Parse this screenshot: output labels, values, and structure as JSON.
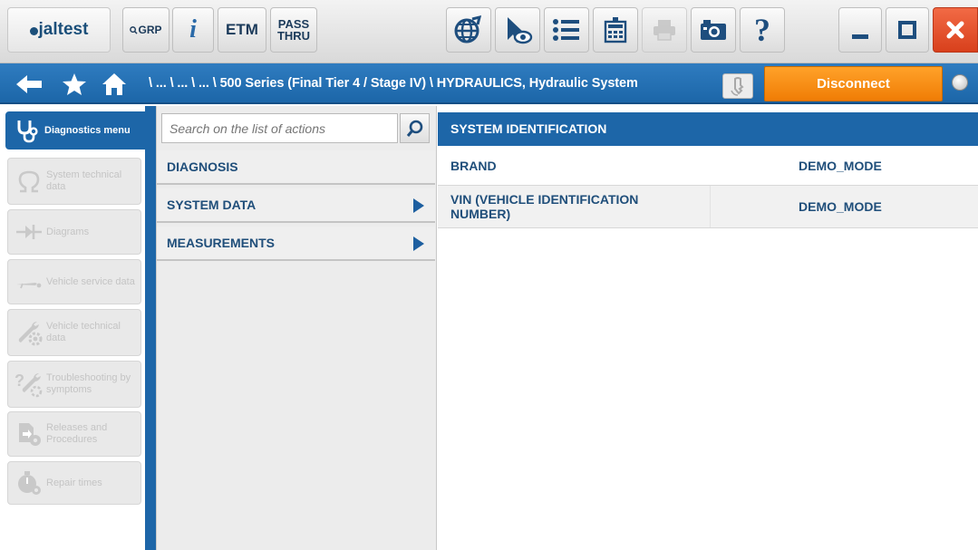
{
  "toolbar": {
    "logo_text": "jaltest",
    "grp_label": "GRP",
    "info_label": "i",
    "etm_label": "ETM",
    "passthru_line1": "PASS",
    "passthru_line2": "THRU",
    "help_label": "?"
  },
  "breadcrumb": {
    "path": "\\ ... \\ ... \\ ... \\ 500 Series (Final Tier 4 / Stage IV) \\ HYDRAULICS, Hydraulic System"
  },
  "disconnect_label": "Disconnect",
  "left_menu": {
    "items": [
      {
        "label": "Diagnostics menu",
        "icon": "stethoscope-icon",
        "active": true
      },
      {
        "label": "System technical data",
        "icon": "omega-icon",
        "active": false
      },
      {
        "label": "Diagrams",
        "icon": "diode-icon",
        "active": false
      },
      {
        "label": "Vehicle service data",
        "icon": "dipstick-icon",
        "active": false
      },
      {
        "label": "Vehicle technical data",
        "icon": "wrench-gear-icon",
        "active": false
      },
      {
        "label": "Troubleshooting by symptoms",
        "icon": "question-wrench-icon",
        "active": false
      },
      {
        "label": "Releases and Procedures",
        "icon": "document-gear-icon",
        "active": false
      },
      {
        "label": "Repair times",
        "icon": "stopwatch-icon",
        "active": false
      }
    ]
  },
  "search": {
    "placeholder": "Search on the list of actions"
  },
  "actions": [
    {
      "label": "DIAGNOSIS",
      "has_arrow": false
    },
    {
      "label": "SYSTEM DATA",
      "has_arrow": true
    },
    {
      "label": "MEASUREMENTS",
      "has_arrow": true
    }
  ],
  "panel": {
    "title": "SYSTEM IDENTIFICATION",
    "rows": [
      {
        "key": "BRAND",
        "value": "DEMO_MODE"
      },
      {
        "key": "VIN (VEHICLE IDENTIFICATION NUMBER)",
        "value": "DEMO_MODE"
      }
    ]
  },
  "colors": {
    "accent_blue": "#1d66a8",
    "disconnect_orange": "#f58a0f",
    "close_red": "#e5512d",
    "text_navy": "#1f4e7a"
  }
}
